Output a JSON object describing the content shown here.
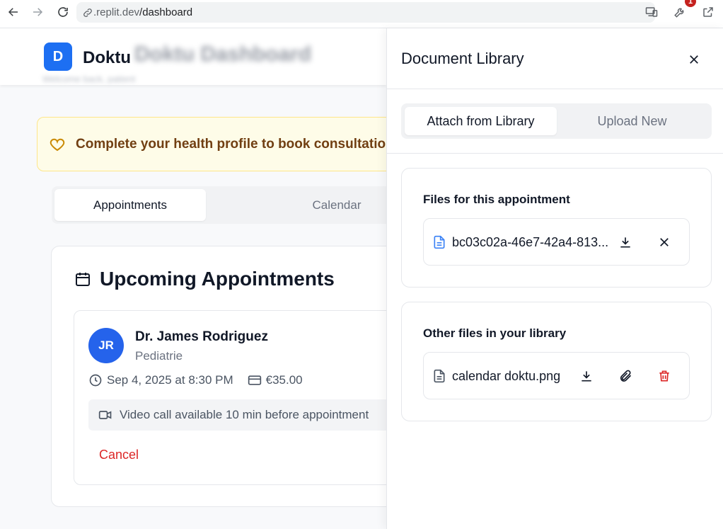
{
  "browser": {
    "url_host": ".replit.dev",
    "url_path": "/dashboard",
    "extension_badge": "1"
  },
  "app": {
    "logo_letter": "D",
    "brand": "Doktu",
    "blurred_title": "Doktu Dashboard",
    "blurred_subtitle": "Welcome back, patient"
  },
  "banner": {
    "text": "Complete your health profile to book consultations"
  },
  "dash_tabs": {
    "appointments": "Appointments",
    "calendar": "Calendar"
  },
  "upcoming": {
    "title": "Upcoming Appointments",
    "appointment": {
      "initials": "JR",
      "doctor": "Dr. James Rodriguez",
      "specialty": "Pediatrie",
      "datetime": "Sep 4, 2025 at 8:30 PM",
      "price": "€35.00",
      "video_note": "Video call available 10 min before appointment",
      "cancel": "Cancel"
    }
  },
  "library": {
    "title": "Document Library",
    "tab_attach": "Attach from Library",
    "tab_upload": "Upload New",
    "section_this": {
      "title": "Files for this appointment",
      "files": [
        {
          "name": "bc03c02a-46e7-42a4-813..."
        }
      ]
    },
    "section_other": {
      "title": "Other files in your library",
      "files": [
        {
          "name": "calendar doktu.png"
        }
      ]
    }
  },
  "colors": {
    "brand_blue": "#1d6ff2",
    "danger": "#dc2626",
    "banner_bg": "#fefce8",
    "banner_text": "#713f12",
    "icon_heart": "#ca8a04"
  }
}
